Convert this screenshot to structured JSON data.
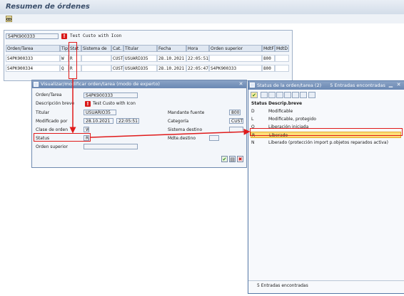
{
  "window": {
    "title": "Resumen de órdenes"
  },
  "list": {
    "header_order_id": "S4PK900333",
    "header_desc": "Test Custo with Icon",
    "columns": [
      "Orden/Tarea",
      "Tip",
      "Stat",
      "Sistema de",
      "Cat.",
      "Titular",
      "Fecha",
      "Hora",
      "Orden superior",
      "MdtF",
      "MdtD"
    ],
    "rows": [
      [
        "S4PK900333",
        "W",
        "R",
        "",
        "CUST",
        "USUARIO35",
        "28.10.2021",
        "22:05:51",
        "",
        "800",
        ""
      ],
      [
        "S4PK900334",
        "Q",
        "R",
        "",
        "CUST",
        "USUARIO35",
        "28.10.2021",
        "22:05:47",
        "S4PK900333",
        "800",
        ""
      ]
    ]
  },
  "detail": {
    "title": "Visualizar/modificar orden/tarea (modo de experto)",
    "order_label": "Orden/Tarea",
    "order_value": "S4PK900333",
    "desc_label": "Descripción breve",
    "desc_value": "Test Custo with Icon",
    "owner_label": "Titular",
    "owner_value": "USUARIO35",
    "modified_label": "Modificado por",
    "modified_date": "28.10.2021",
    "modified_time": "22:05:51",
    "class_label": "Clase de orden",
    "class_value": "W",
    "status_label": "Status",
    "status_value": "R",
    "parent_label": "Orden superior",
    "parent_value": "",
    "client_src_label": "Mandante fuente",
    "client_src_value": "800",
    "category_label": "Categoría",
    "category_value": "CUST",
    "target_sys_label": "Sistema destino",
    "target_sys_value": "",
    "target_client_label": "Mdte.destino",
    "target_client_value": ""
  },
  "statuslist": {
    "title": "Status de la orden/tarea (2)",
    "count_text": "5 Entradas encontradas",
    "col_status": "Status",
    "col_desc": "Descrip.breve",
    "rows": [
      {
        "code": "D",
        "desc": "Modificable"
      },
      {
        "code": "L",
        "desc": "Modificable, protegido"
      },
      {
        "code": "O",
        "desc": "Liberación iniciada"
      },
      {
        "code": "R",
        "desc": "Liberado"
      },
      {
        "code": "N",
        "desc": "Liberado (protección import p.objetos reparados activa)"
      }
    ],
    "selected_index": 3,
    "footer": "5 Entradas encontradas"
  },
  "icons": {
    "toolbar": "glasses-icon",
    "error": "red-exclamation-icon",
    "confirm": "green-check-icon",
    "cancel": "red-x-icon"
  },
  "colors": {
    "highlight": "#e01a1a",
    "selected_row": "#fddf7a",
    "dialog_header": "#6a88b3"
  }
}
